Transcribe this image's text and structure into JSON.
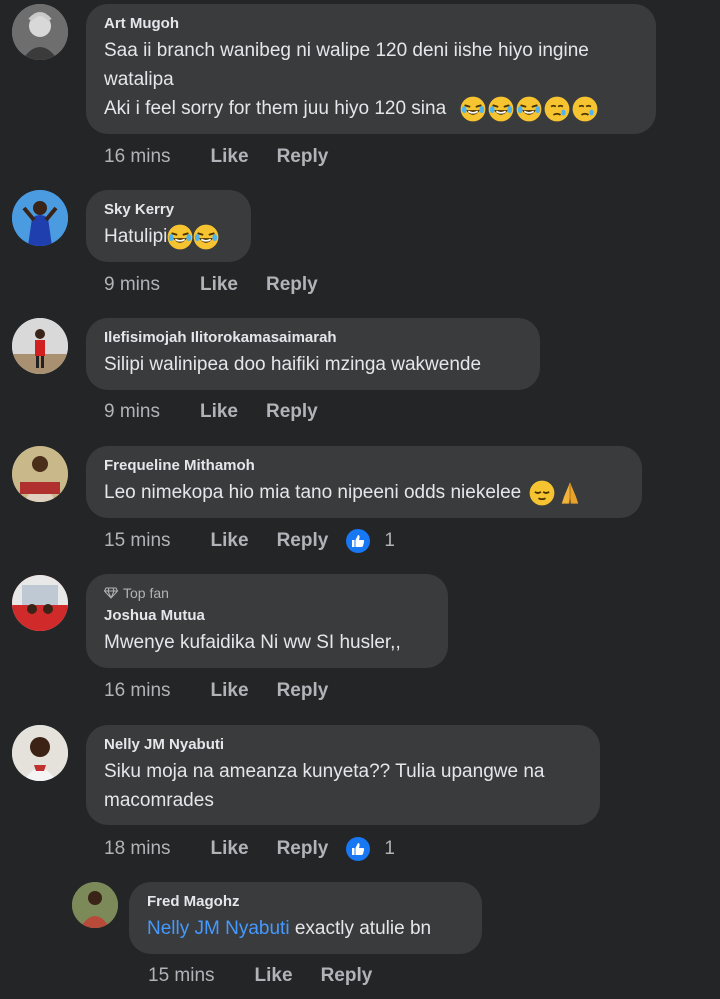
{
  "comments": [
    {
      "name": "Art Mugoh",
      "line1": "Saa ii branch wanibeg ni walipe 120 deni iishe hiyo ingine",
      "line2": "watalipa",
      "line3": "Aki i feel sorry for them juu hiyo 120 sina",
      "time": "16 mins",
      "like": "Like",
      "reply": "Reply"
    },
    {
      "name": "Sky Kerry",
      "text": "Hatulipi",
      "time": "9 mins",
      "like": "Like",
      "reply": "Reply"
    },
    {
      "name": "Ilefisimojah Ilitorokamasaimarah",
      "text": "Silipi walinipea doo haifiki mzinga wakwende",
      "time": "9 mins",
      "like": "Like",
      "reply": "Reply"
    },
    {
      "name": "Frequeline Mithamoh",
      "text": "Leo nimekopa hio mia tano nipeeni odds niekelee",
      "time": "15 mins",
      "like": "Like",
      "reply": "Reply",
      "reaction_count": "1"
    },
    {
      "badge": "Top fan",
      "name": "Joshua Mutua",
      "text": "Mwenye kufaidika Ni ww SI husler,,",
      "time": "16 mins",
      "like": "Like",
      "reply": "Reply"
    },
    {
      "name": "Nelly JM Nyabuti",
      "line1": "Siku moja na ameanza kunyeta?? Tulia upangwe na",
      "line2": "macomrades",
      "time": "18 mins",
      "like": "Like",
      "reply": "Reply",
      "reaction_count": "1"
    },
    {
      "name": "Fred Magohz",
      "mention": "Nelly JM Nyabuti",
      "text": " exactly atulie bn",
      "time": "15 mins",
      "like": "Like",
      "reply": "Reply"
    }
  ],
  "colors": {
    "background": "#242526",
    "bubble": "#3a3b3c",
    "mention": "#4599ff",
    "like_badge": "#1877f2"
  },
  "icons": [
    "laughing-emoji-icon",
    "sad-emoji-icon",
    "relieved-emoji-icon",
    "praying-hands-icon",
    "thumbs-up-icon",
    "diamond-icon"
  ]
}
